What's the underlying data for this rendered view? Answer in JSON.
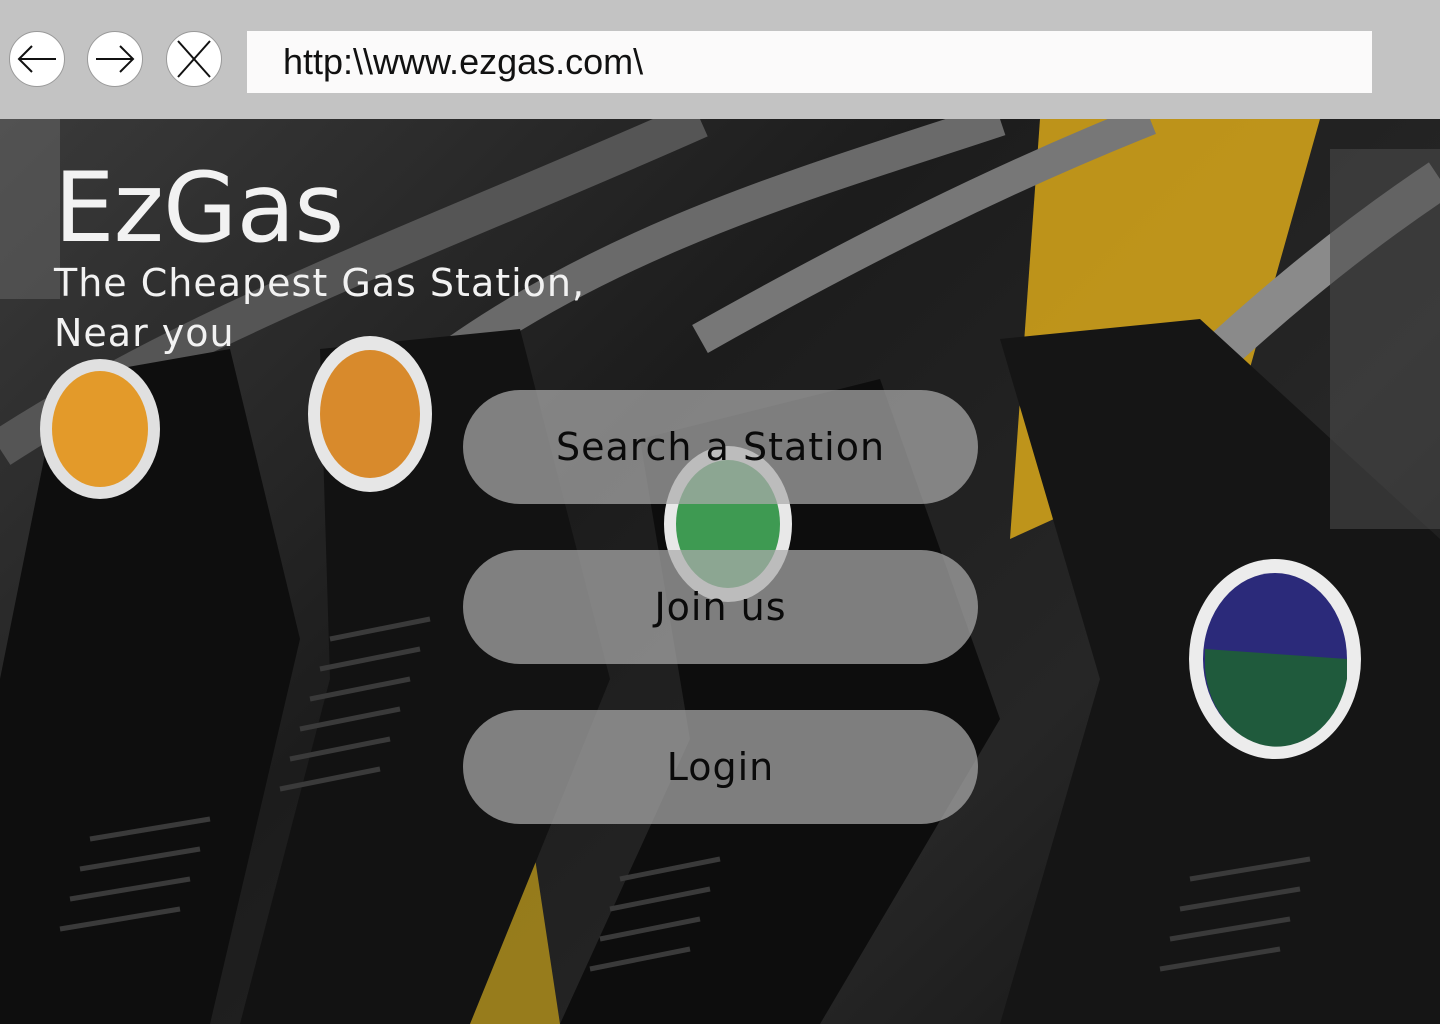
{
  "browser": {
    "url": "http:\\\\www.ezgas.com\\",
    "back_icon": "arrow-left-icon",
    "forward_icon": "arrow-right-icon",
    "close_icon": "close-icon"
  },
  "hero": {
    "background": "photo of gas station fuel pump nozzles",
    "brand": "EzGas",
    "tagline_line1": "The Cheapest Gas Station,",
    "tagline_line2": "Near you"
  },
  "actions": {
    "search_label": "Search a Station",
    "join_label": "Join us",
    "login_label": "Login"
  },
  "colors": {
    "browser_bar": "#c3c3c3",
    "url_bar": "#fbfafa",
    "button_fill": "#aaaaaa",
    "brand_text": "#f2f2f2"
  }
}
